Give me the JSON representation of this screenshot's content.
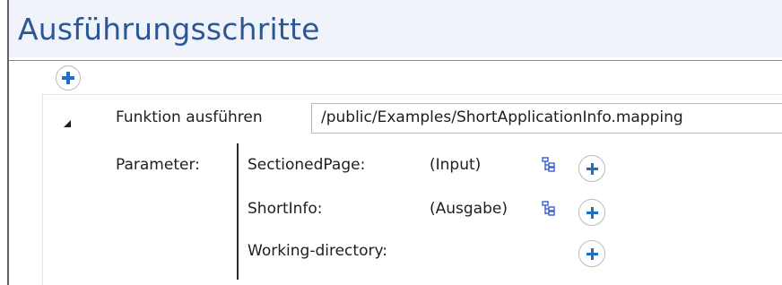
{
  "section": {
    "title": "Ausführungsschritte",
    "add_step_icon": "plus-icon"
  },
  "step": {
    "label": "Funktion ausführen",
    "path": "/public/Examples/ShortApplicationInfo.mapping",
    "collapse_icon": "triangle-down-icon",
    "parameters_label": "Parameter:",
    "parameters": [
      {
        "name": "SectionedPage:",
        "direction": "(Input)",
        "icon": "tree-structure-icon",
        "add_icon": "plus-icon"
      },
      {
        "name": "ShortInfo:",
        "direction": "(Ausgabe)",
        "icon": "tree-structure-icon",
        "add_icon": "plus-icon"
      },
      {
        "name": "Working-directory:",
        "direction": "",
        "add_icon": "plus-icon"
      }
    ]
  },
  "colors": {
    "title": "#2b5797",
    "header_bg": "#f0f4fa",
    "plus": "#1f6fc4",
    "icon_tree": "#3a5fcd"
  }
}
